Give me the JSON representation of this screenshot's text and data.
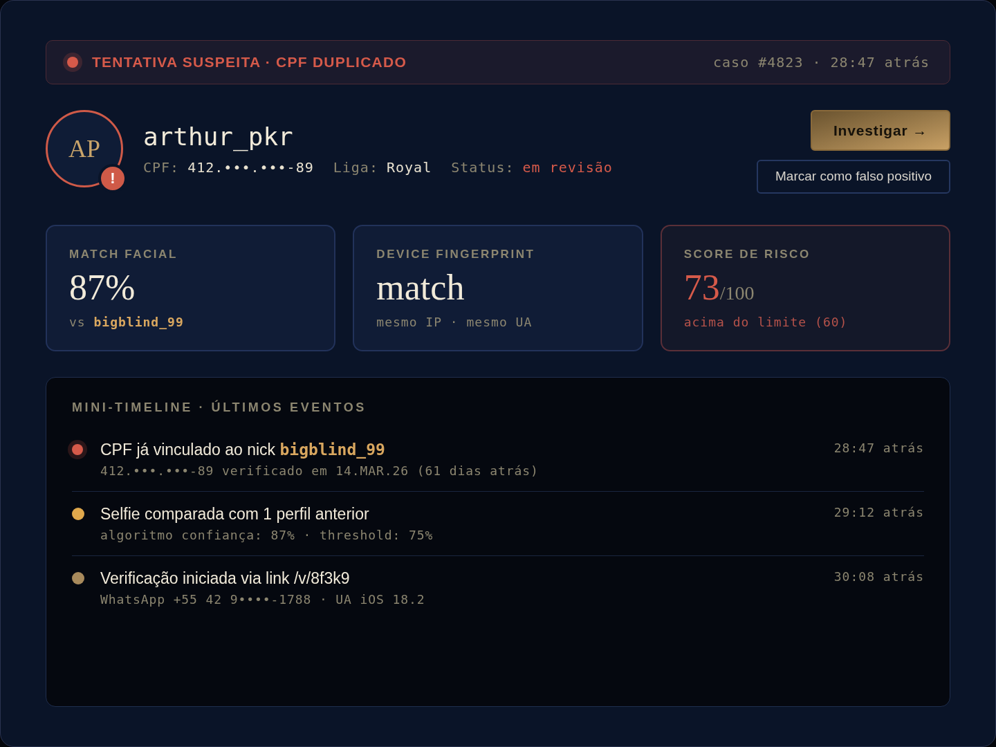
{
  "alert_banner": {
    "title": "TENTATIVA SUSPEITA · CPF DUPLICADO",
    "meta": "caso #4823 · 28:47 atrás"
  },
  "profile": {
    "initials": "AP",
    "badge": "!",
    "username": "arthur_pkr",
    "fields": [
      {
        "label": "CPF:",
        "value": "412.•••.•••-89",
        "flagged": false
      },
      {
        "label": "Liga:",
        "value": "Royal",
        "flagged": false
      },
      {
        "label": "Status:",
        "value": "em revisão",
        "flagged": true
      }
    ]
  },
  "actions": [
    {
      "label": "Investigar →",
      "kind": "primary"
    },
    {
      "label": "Marcar como falso positivo",
      "kind": "secondary"
    }
  ],
  "metrics": [
    {
      "label": "MATCH FACIAL",
      "value": "87%",
      "detail": "vs **bigblind_99**",
      "alert": false
    },
    {
      "label": "DEVICE FINGERPRINT",
      "value": "match",
      "detail": "mesmo IP · mesmo UA",
      "alert": false
    },
    {
      "label": "SCORE DE RISCO",
      "value": "73",
      "scale": "/100",
      "detail": "acima do limite (60)",
      "alert": true
    }
  ],
  "timeline": {
    "title": "MINI-TIMELINE · ÚLTIMOS EVENTOS",
    "events": [
      {
        "title": "CPF já vinculado ao nick **bigblind_99**",
        "detail": "412.•••.•••-89 verificado em 14.MAR.26 (61 dias atrás)",
        "time": "28:47 atrás",
        "color": "#d65a4a",
        "active": true
      },
      {
        "title": "Selfie comparada com 1 perfil anterior",
        "detail": "algoritmo confiança: 87% · threshold: 75%",
        "time": "29:12 atrás",
        "color": "#e0a84c",
        "active": false
      },
      {
        "title": "Verificação iniciada via link /v/8f3k9",
        "detail": "WhatsApp +55 42 9••••-1788 · UA iOS 18.2",
        "time": "30:08 atrás",
        "color": "#a88a5c",
        "active": false
      }
    ]
  }
}
